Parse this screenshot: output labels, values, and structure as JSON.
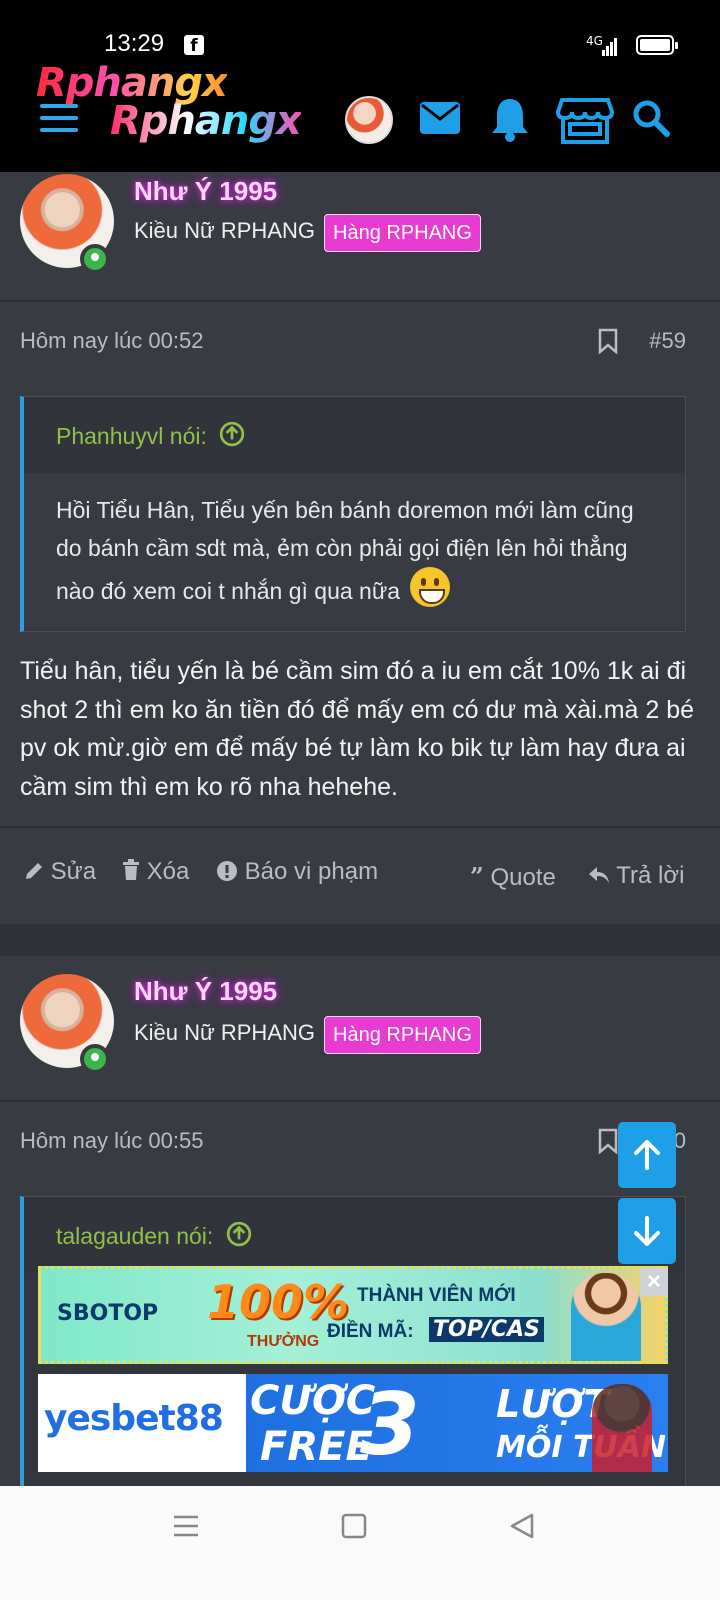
{
  "status_bar": {
    "time": "13:29",
    "network": "4G"
  },
  "header": {
    "logo_line1": "Rphangx",
    "logo_line2": "Rphangx"
  },
  "posts": [
    {
      "username": "Như Ý 1995",
      "user_title": "Kiều Nữ RPHANG",
      "badge": "Hàng RPHANG",
      "date": "Hôm nay lúc 00:52",
      "number": "#59",
      "quote": {
        "author": "Phanhuyvl nói:",
        "text": "Hồi Tiểu Hân, Tiểu yến bên bánh doremon mới làm cũng do bánh cầm sdt mà, ẻm còn phải gọi điện lên hỏi thẳng nào đó xem coi t nhắn gì qua nữa"
      },
      "text": "Tiểu hân, tiểu yến là bé cầm sim đó a iu em cắt 10% 1k ai đi shot 2 thì em ko ăn tiền đó để mấy em có dư mà xài.mà 2 bé pv ok mừ.giờ em để mấy bé tự làm ko bik tự làm hay đưa ai cầm sim thì em ko rõ nha hehehe.",
      "actions": {
        "edit": "Sửa",
        "delete": "Xóa",
        "report": "Báo vi phạm",
        "quote": "Quote",
        "reply": "Trả lời"
      }
    },
    {
      "username": "Như Ý 1995",
      "user_title": "Kiều Nữ RPHANG",
      "badge": "Hàng RPHANG",
      "date": "Hôm nay lúc 00:55",
      "number": "0",
      "quote": {
        "author": "talagauden nói:"
      }
    }
  ],
  "ads": [
    {
      "brand": "SBOTOP",
      "headline": "100%",
      "sub": "THƯỞNG",
      "line1": "THÀNH VIÊN MỚI",
      "line2": "ĐIỀN MÃ:",
      "code": "TOP/CAS"
    },
    {
      "brand": "yesbet88",
      "line1": "CƯỢC",
      "line2": "FREE",
      "num": "3",
      "right1": "LƯỢT",
      "right2": "MỖI TUẦN"
    }
  ],
  "colors": {
    "accent": "#1e9fe8",
    "username_glow": "#d32bd3",
    "badge": "#e83bd2",
    "quote_author": "#8fc14a",
    "background": "#2f3238"
  }
}
